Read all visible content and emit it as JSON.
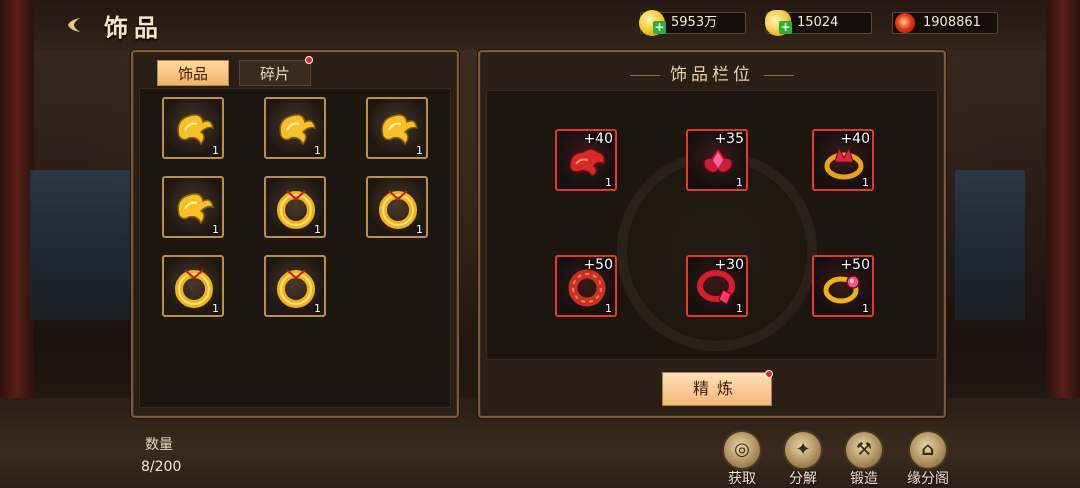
{
  "header": {
    "back_icon": "back-arrow-icon",
    "title": "饰品",
    "resources": [
      {
        "name": "gold-coin",
        "value": "5953万"
      },
      {
        "name": "gold-ingot",
        "value": "15024"
      },
      {
        "name": "red-jade",
        "value": "1908861"
      }
    ]
  },
  "inventory": {
    "tabs": [
      {
        "label": "饰品",
        "active": true
      },
      {
        "label": "碎片",
        "active": false,
        "has_notification": true
      }
    ],
    "items": [
      {
        "type": "gold-cloud-pendant",
        "qty": "1"
      },
      {
        "type": "gold-cloud-pendant",
        "qty": "1"
      },
      {
        "type": "gold-cloud-pendant",
        "qty": "1"
      },
      {
        "type": "gold-cloud-pendant",
        "qty": "1"
      },
      {
        "type": "gold-ring-pendant",
        "qty": "1"
      },
      {
        "type": "gold-ring-pendant",
        "qty": "1"
      },
      {
        "type": "gold-ring-pendant",
        "qty": "1"
      },
      {
        "type": "gold-ring-pendant",
        "qty": "1"
      }
    ]
  },
  "slots": {
    "title": "饰品栏位",
    "items": [
      {
        "type": "red-cloud-pendant",
        "level": "+40",
        "qty": "1"
      },
      {
        "type": "red-gem-brooch",
        "level": "+35",
        "qty": "1"
      },
      {
        "type": "red-crown-ring",
        "level": "+40",
        "qty": "1"
      },
      {
        "type": "red-bead-ring",
        "level": "+50",
        "qty": "1"
      },
      {
        "type": "red-gem-ring",
        "level": "+30",
        "qty": "1"
      },
      {
        "type": "gold-gem-ring",
        "level": "+50",
        "qty": "1"
      }
    ],
    "refine_label": "精炼",
    "refine_has_notification": true
  },
  "footer": {
    "count_label": "数量",
    "count_value": "8/200",
    "actions": [
      {
        "label": "获取",
        "icon": "acquire-icon"
      },
      {
        "label": "分解",
        "icon": "decompose-icon"
      },
      {
        "label": "锻造",
        "icon": "forge-hammer-icon"
      },
      {
        "label": "缘分阁",
        "icon": "pavilion-icon"
      }
    ]
  },
  "colors": {
    "frame": "#7e5b36",
    "tab_active": "#f1b46a",
    "equipped_border": "#e23a2d",
    "inventory_border": "#b98f4b",
    "notification": "#e82626"
  }
}
